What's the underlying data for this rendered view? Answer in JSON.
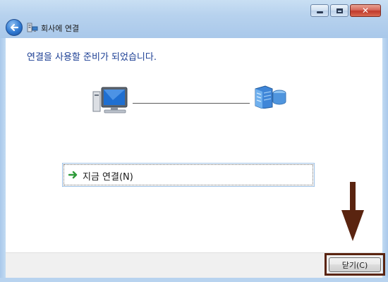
{
  "window": {
    "title": "회사에 연결",
    "caption_buttons": [
      "minimize-icon",
      "maximize-icon",
      "close-icon"
    ],
    "close_glyph": "✕"
  },
  "content": {
    "heading": "연결을 사용할 준비가 되었습니다.",
    "left_icon": "computer-icon",
    "right_icon": "server-icon"
  },
  "connect_option": {
    "label": "지금 연결(N)",
    "icon": "green-arrow-icon"
  },
  "footer": {
    "close_label": "닫기(C)"
  },
  "annotation": {
    "color": "#5a2410"
  },
  "colors": {
    "heading": "#1c3f94",
    "title_bar": "#b7d2ee",
    "annotation": "#5a2410"
  }
}
